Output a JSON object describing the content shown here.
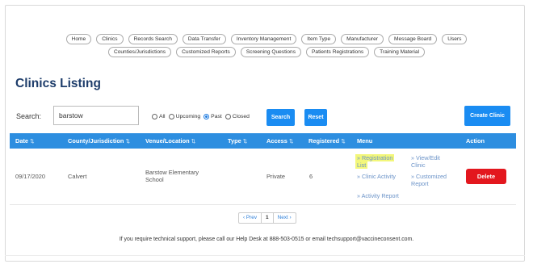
{
  "nav": {
    "row1": [
      "Home",
      "Clinics",
      "Records Search",
      "Data Transfer",
      "Inventory Management",
      "Item Type",
      "Manufacturer",
      "Message Board",
      "Users"
    ],
    "row2": [
      "Counties/Jurisdictions",
      "Customized Reports",
      "Screening Questions",
      "Patients Registrations",
      "Training Material"
    ]
  },
  "page_title": "Clinics Listing",
  "search": {
    "label": "Search:",
    "value": "barstow"
  },
  "filters": {
    "options": [
      "All",
      "Upcoming",
      "Past",
      "Closed"
    ],
    "selected": "Past"
  },
  "buttons": {
    "search": "Search",
    "reset": "Reset",
    "create": "Create Clinic"
  },
  "table": {
    "headers": [
      "Date",
      "County/Jurisdiction",
      "Venue/Location",
      "Type",
      "Access",
      "Registered",
      "Menu",
      "Action"
    ],
    "row": {
      "date": "09/17/2020",
      "county": "Calvert",
      "venue_line1": "Barstow Elementary",
      "venue_line2": "School",
      "type": "",
      "access": "Private",
      "registered": "6",
      "menu": {
        "registration_list_1": "» Registration",
        "registration_list_2": "List",
        "view_edit_1": "» View/Edit",
        "view_edit_2": "Clinic",
        "clinic_activity": "» Clinic Activity",
        "customized_report_1": "» Customized",
        "customized_report_2": "Report",
        "activity_report": "» Activity Report"
      },
      "action": "Delete"
    }
  },
  "pagination": {
    "prev": "‹ Prev",
    "current": "1",
    "next": "Next ›"
  },
  "support_text": "If you require technical support, please call our Help Desk at 888-503-0515 or email techsupport@vaccineconsent.com.",
  "colors": {
    "accent": "#1a8cf2",
    "title": "#1e3d6b",
    "delete": "#e3171e",
    "highlight": "#f3f77a"
  }
}
